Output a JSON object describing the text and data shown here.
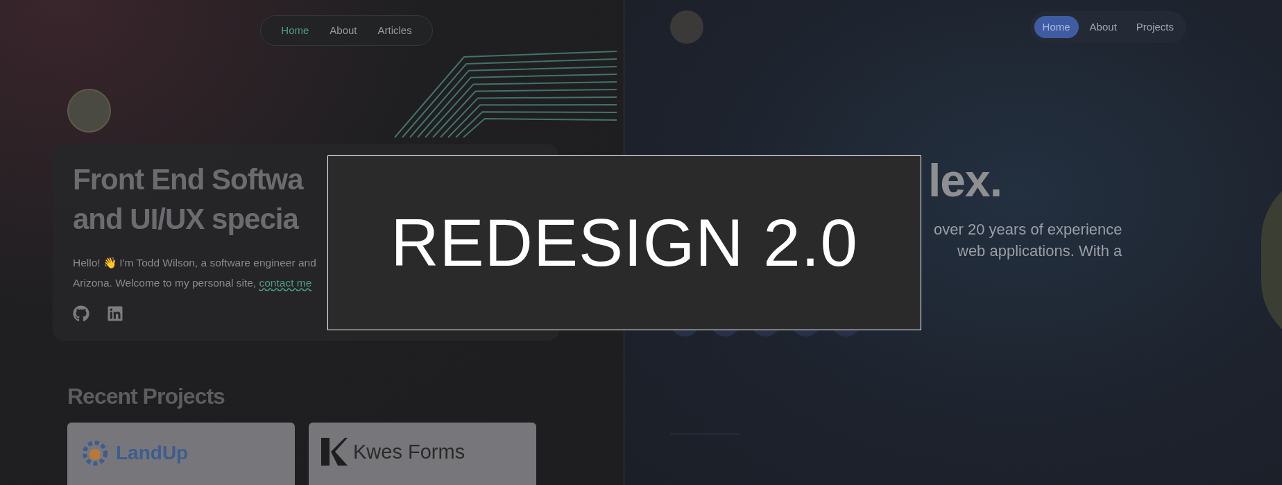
{
  "left_site": {
    "nav": [
      {
        "label": "Home",
        "selected": true
      },
      {
        "label": "About",
        "selected": false
      },
      {
        "label": "Articles",
        "selected": false
      }
    ],
    "heading_lines": [
      "Front End Softwa",
      "and UI/UX specia"
    ],
    "intro": {
      "line_1": "Hello! 👋 I'm Todd Wilson, a software engineer and",
      "line_2": "Arizona. Welcome to my personal site, ",
      "link": "contact me"
    },
    "section_title": "Recent Projects",
    "projects": [
      {
        "kind": "landup",
        "name": "LandUp"
      },
      {
        "kind": "kwes",
        "name": "Kwes Forms"
      }
    ]
  },
  "right_site": {
    "nav": [
      {
        "label": "Home",
        "selected": true
      },
      {
        "label": "About",
        "selected": false
      },
      {
        "label": "Projects",
        "selected": false
      }
    ],
    "heading": "lex.",
    "intro_lines": [
      "over 20 years of experience",
      "web applications. With a"
    ]
  },
  "overlay": {
    "title": "REDESIGN 2.0"
  }
}
